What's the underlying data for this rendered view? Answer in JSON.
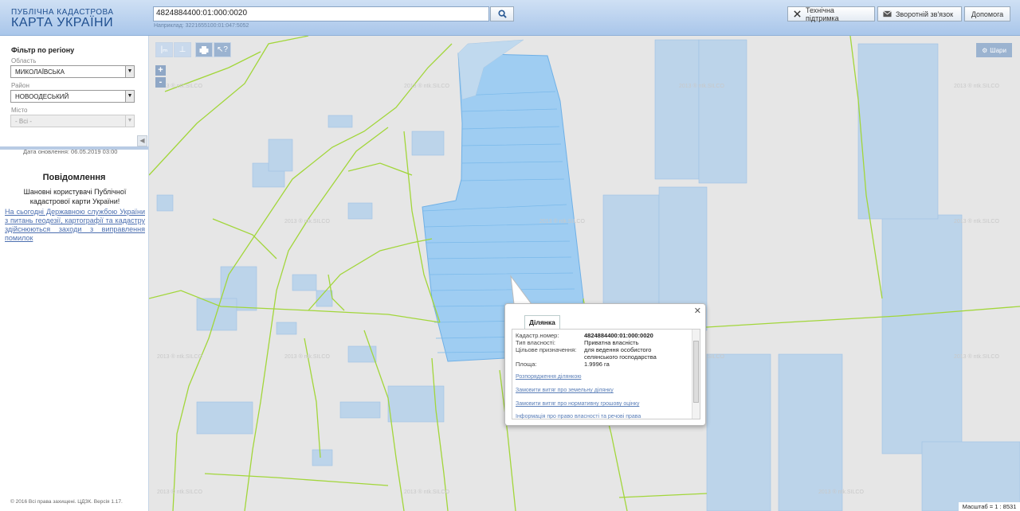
{
  "header": {
    "logo_line1": "ПУБЛІЧНА КАДАСТРОВА",
    "logo_line2": "КАРТА УКРАЇНИ",
    "search_value": "4824884400:01:000:0020",
    "search_hint": "Наприклад: 3221655100:01:047:5052",
    "buttons": [
      "Технічна підтримка",
      "Зворотній зв'язок",
      "Допомога"
    ]
  },
  "sidebar": {
    "filter_title": "Фільтр по регіону",
    "oblast_label": "Область",
    "oblast_value": "МИКОЛАЇВСЬКА",
    "rayon_label": "Район",
    "rayon_value": "НОВООДЕСЬКИЙ",
    "misto_label": "Місто",
    "misto_value": "- Всі -",
    "update_date": "Дата оновлення: 06.05.2019 03:00",
    "news_title": "Повідомлення",
    "news_text": "Шановні користувачі Публічної кадастрової карти України!",
    "news_link": "На сьогодні Державною службою України з питань геодезії, картографії та кадастру здійснюються заходи з виправлення помилок",
    "copyright": "© 2016 Всі права захищені. ЦДЗК. Версія 1.17."
  },
  "map": {
    "layers_label": "Шари",
    "zoom_in": "+",
    "zoom_out": "-",
    "scale_text": "Масштаб = 1 : 8531",
    "watermark": "2013 ® ntk.SILCO",
    "parcel_color": "#9fcdf2",
    "boundary_color": "#a2d63a"
  },
  "popup": {
    "tab": "Ділянка",
    "rows": [
      {
        "label": "Кадастр.номер:",
        "value": "4824884400:01:000:0020"
      },
      {
        "label": "Тип власності:",
        "value": "Приватна власність"
      },
      {
        "label": "Цільове призначення:",
        "value": "для ведення особистого селянського господарства"
      },
      {
        "label": "Площа:",
        "value": "1.9996 га"
      }
    ],
    "links": [
      "Розпорядження ділянкою",
      "Замовити витяг про земельну ділянку",
      "Замовити витяг про нормативну грошову оцінку",
      "Інформація про право власності та речові права"
    ]
  }
}
